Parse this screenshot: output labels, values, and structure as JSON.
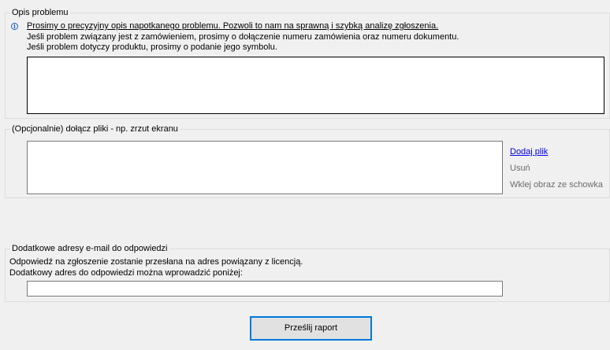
{
  "problem_section": {
    "title": "Opis problemu",
    "info_underlined": "Prosimy o precyzyjny opis napotkanego problemu. Pozwoli to nam na sprawną i szybką analizę zgłoszenia.",
    "info_line2": "Jeśli problem związany jest z zamówieniem, prosimy o dołączenie numeru zamówienia oraz numeru dokumentu.",
    "info_line3": "Jeśli problem dotyczy produktu, prosimy o podanie jego symbolu.",
    "description_value": ""
  },
  "attachments_section": {
    "title": "(Opcjonalnie) dołącz pliki - np. zrzut ekranu",
    "add_file": "Dodaj plik",
    "remove": "Usuń",
    "paste_image": "Wklej obraz ze schowka"
  },
  "email_section": {
    "title": "Dodatkowe adresy e-mail do odpowiedzi",
    "line1": "Odpowiedź na zgłoszenie zostanie przesłana na adres powiązany z licencją.",
    "line2": "Dodatkowy adres do odpowiedzi można wprowadzić poniżej:",
    "email_value": ""
  },
  "submit_label": "Prześlij raport"
}
